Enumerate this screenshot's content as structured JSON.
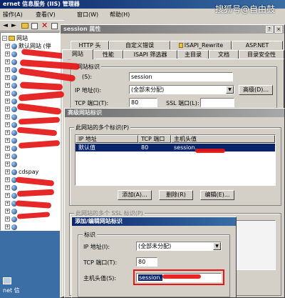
{
  "main_window": {
    "title": "ernet 信息服务 (IIS) 管理器",
    "menu": [
      "操作(A)",
      "查看(V)",
      "窗口(W)",
      "帮助(H)"
    ],
    "tree_root": "网站",
    "tree_items": [
      "默认网站 (停",
      "cdspay"
    ]
  },
  "watermark": "搜狐号@自由鼓",
  "props": {
    "title": "session 属性",
    "tabs_row1": [
      "HTTP 头",
      "自定义错误",
      "ISAPI_Rewrite",
      "ASP.NET"
    ],
    "tabs_row2": [
      "网站",
      "性能",
      "ISAPI 筛选器",
      "主目录",
      "文档",
      "目录安全性"
    ],
    "group_label": "网站标识",
    "desc_label": "(S):",
    "desc_value": "session",
    "ip_label": "IP 地址(I):",
    "ip_value": "(全部未分配)",
    "advanced_label": "高级(D)...",
    "tcp_label": "TCP 端口(T):",
    "tcp_value": "80",
    "ssl_label": "SSL 端口(L):"
  },
  "advanced": {
    "title": "高级网站标识",
    "group_label": "此网站的多个标识(P)",
    "headers": [
      "IP 地址",
      "TCP 端口",
      "主机头值"
    ],
    "row": {
      "ip": "默认值",
      "port": "80",
      "host": "session."
    },
    "add_label": "添加(A)...",
    "delete_label": "删除(R)",
    "edit_label": "编辑(E)...",
    "group2_label": "此网站的多个 SSL 标识(P)"
  },
  "edit_dialog": {
    "title": "添加/编辑网站标识",
    "group_label": "标识",
    "ip_label": "IP 地址(I):",
    "ip_value": "(全部未分配)",
    "tcp_label": "TCP 端口(T):",
    "tcp_value": "80",
    "host_label": "主机头值(S):",
    "host_value": "session."
  },
  "taskbar": {
    "item": "net 信"
  }
}
